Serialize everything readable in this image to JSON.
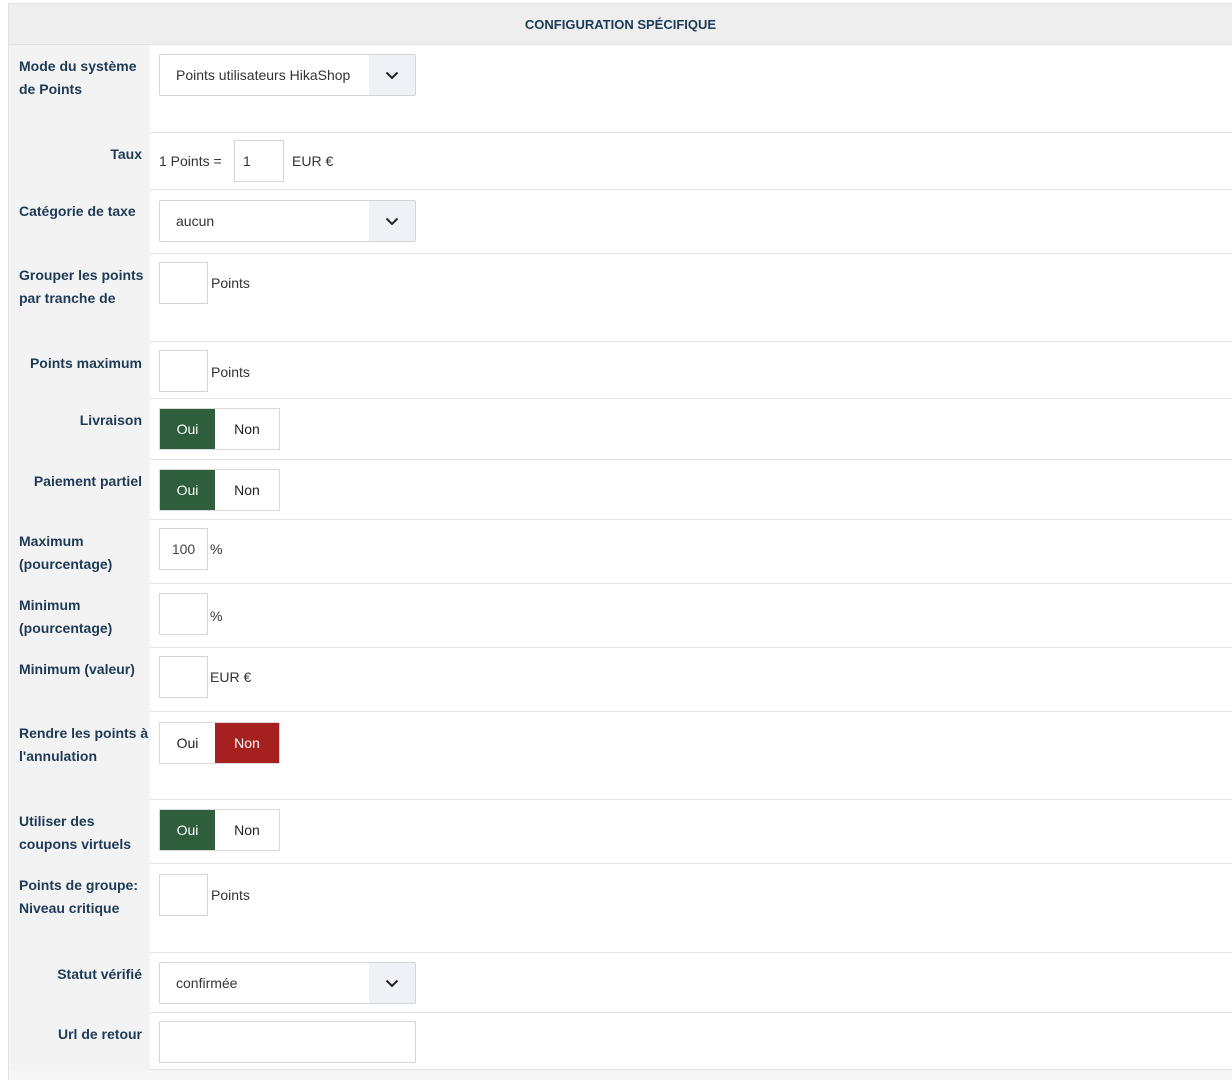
{
  "header": {
    "title": "CONFIGURATION SPÉCIFIQUE"
  },
  "rows": {
    "mode": {
      "label": "Mode du système de Points",
      "value": "Points utilisateurs HikaShop"
    },
    "taux": {
      "label": "Taux",
      "prefix": "1 Points =",
      "value": "1",
      "unit": "EUR €"
    },
    "taxe": {
      "label": "Catégorie de taxe",
      "value": "aucun"
    },
    "grouper": {
      "label": "Grouper les points par tranche de",
      "value": "",
      "unit": "Points"
    },
    "pointsmax": {
      "label": "Points maximum",
      "value": "",
      "unit": "Points"
    },
    "livraison": {
      "label": "Livraison",
      "yes": "Oui",
      "no": "Non",
      "selected": "Oui"
    },
    "paiement": {
      "label": "Paiement partiel",
      "yes": "Oui",
      "no": "Non",
      "selected": "Oui"
    },
    "maxpct": {
      "label": "Maximum (pourcentage)",
      "value": "100",
      "unit": "%"
    },
    "minpct": {
      "label": "Minimum (pourcentage)",
      "value": "",
      "unit": "%"
    },
    "minval": {
      "label": "Minimum (valeur)",
      "value": "",
      "unit": "EUR €"
    },
    "rendre": {
      "label": "Rendre les points à l'annulation",
      "yes": "Oui",
      "no": "Non",
      "selected": "Non"
    },
    "coupons": {
      "label": "Utiliser des coupons virtuels",
      "yes": "Oui",
      "no": "Non",
      "selected": "Oui"
    },
    "groupe": {
      "label": "Points de groupe: Niveau critique",
      "value": "",
      "unit": "Points"
    },
    "statut": {
      "label": "Statut vérifié",
      "value": "confirmée"
    },
    "url": {
      "label": "Url de retour",
      "value": ""
    }
  },
  "colors": {
    "label_text": "#1d3a57",
    "toggle_on": "#2e5e3c",
    "toggle_off_red": "#a5201f"
  },
  "icons": {
    "dropdown": "chevron-down-icon"
  }
}
